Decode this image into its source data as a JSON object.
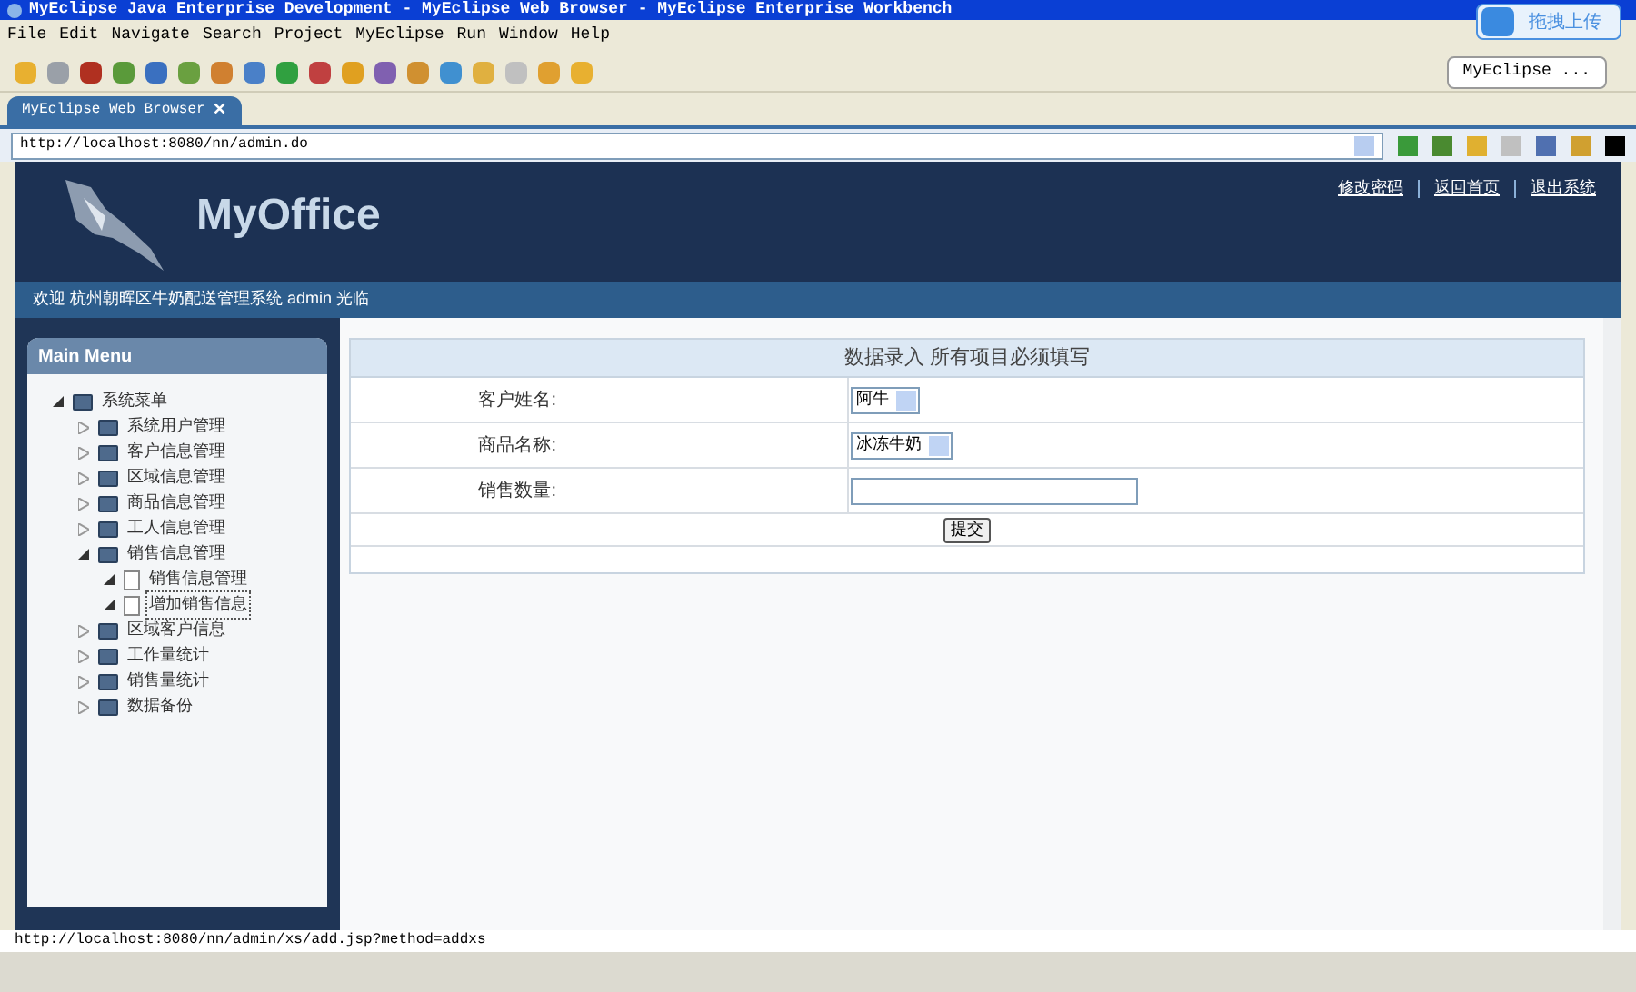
{
  "window": {
    "title": "MyEclipse Java Enterprise Development - MyEclipse Web Browser - MyEclipse Enterprise Workbench"
  },
  "menu_bar": [
    "File",
    "Edit",
    "Navigate",
    "Search",
    "Project",
    "MyEclipse",
    "Run",
    "Window",
    "Help"
  ],
  "upload_widget": {
    "label": "拖拽上传"
  },
  "perspective_button": {
    "label": "MyEclipse ..."
  },
  "editor_tab": {
    "label": "MyEclipse Web Browser",
    "close": "✕"
  },
  "address_field": {
    "value": "http://localhost:8080/nn/admin.do"
  },
  "site": {
    "logo": "MyOffice",
    "links": [
      "修改密码",
      "返回首页",
      "退出系统"
    ],
    "welcome": "欢迎 杭州朝晖区牛奶配送管理系统 admin 光临"
  },
  "sidebar": {
    "title": "Main Menu",
    "tree": [
      {
        "label": "系统菜单",
        "kind": "folder",
        "expanded": true,
        "selected": false,
        "children": [
          {
            "label": "系统用户管理",
            "kind": "folder",
            "expanded": false,
            "selected": false
          },
          {
            "label": "客户信息管理",
            "kind": "folder",
            "expanded": false,
            "selected": false
          },
          {
            "label": "区域信息管理",
            "kind": "folder",
            "expanded": false,
            "selected": false
          },
          {
            "label": "商品信息管理",
            "kind": "folder",
            "expanded": false,
            "selected": false
          },
          {
            "label": "工人信息管理",
            "kind": "folder",
            "expanded": false,
            "selected": false
          },
          {
            "label": "销售信息管理",
            "kind": "folder",
            "expanded": true,
            "selected": false,
            "children": [
              {
                "label": "销售信息管理",
                "kind": "leaf",
                "selected": false
              },
              {
                "label": "增加销售信息",
                "kind": "leaf",
                "selected": true
              }
            ]
          },
          {
            "label": "区域客户信息",
            "kind": "folder",
            "expanded": false,
            "selected": false
          },
          {
            "label": "工作量统计",
            "kind": "folder",
            "expanded": false,
            "selected": false
          },
          {
            "label": "销售量统计",
            "kind": "folder",
            "expanded": false,
            "selected": false
          },
          {
            "label": "数据备份",
            "kind": "folder",
            "expanded": false,
            "selected": false
          }
        ]
      }
    ]
  },
  "form": {
    "heading": "数据录入 所有项目必须填写",
    "fields": [
      {
        "label": "客户姓名:",
        "kind": "select",
        "value": "阿牛"
      },
      {
        "label": "商品名称:",
        "kind": "select",
        "value": "冰冻牛奶"
      },
      {
        "label": "销售数量:",
        "kind": "text"
      }
    ],
    "submit": "提交"
  },
  "status_bar": {
    "text": "http://localhost:8080/nn/admin/xs/add.jsp?method=addxs"
  }
}
